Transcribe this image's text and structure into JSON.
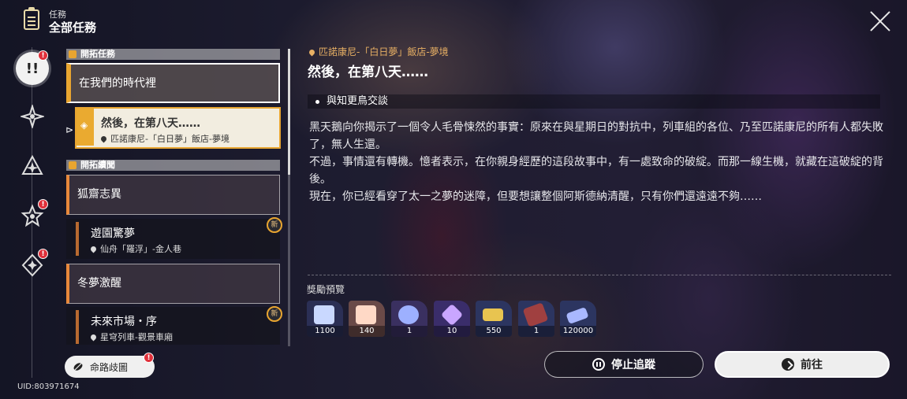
{
  "header": {
    "small_label": "任務",
    "title": "全部任務",
    "icon": "clipboard-icon"
  },
  "close": {
    "icon": "close-icon"
  },
  "rail": [
    {
      "name": "rail-all-quests",
      "icon": "exclamation-icon",
      "label": "!!",
      "badge": "!",
      "active": true
    },
    {
      "name": "rail-trailblaze",
      "icon": "star-compass-icon",
      "badge": ""
    },
    {
      "name": "rail-companion",
      "icon": "triangle-star-icon",
      "badge": ""
    },
    {
      "name": "rail-adventure",
      "icon": "star-icon",
      "badge": "!"
    },
    {
      "name": "rail-daily",
      "icon": "diamond-star-icon",
      "badge": "!"
    }
  ],
  "route_button": {
    "label": "命路歧圖",
    "icon": "leaf-icon",
    "badge": "!"
  },
  "uid": "UID:803971674",
  "sections": [
    {
      "title": "開拓任務"
    },
    {
      "title": "開拓續聞"
    }
  ],
  "quests": {
    "cat1": "在我們的時代裡",
    "cur_title": "然後，在第八天……",
    "cur_loc": "匹諾康尼-「白日夢」飯店-夢境",
    "cat2": "狐齋志異",
    "sub2_title": "遊園驚夢",
    "sub2_loc": "仙舟「羅浮」-金人巷",
    "cat3": "冬夢激醒",
    "sub3_title": "未來市場・序",
    "sub3_loc": "星穹列車-觀景車廂",
    "new_badge": "新"
  },
  "detail": {
    "location": "匹諾康尼-「白日夢」飯店-夢境",
    "title": "然後，在第八天……",
    "objective": "與知更鳥交談",
    "paragraphs": [
      "黑天鵝向你揭示了一個令人毛骨悚然的事實：原來在與星期日的對抗中，列車組的各位、乃至匹諾康尼的所有人都失敗了，無人生還。",
      "不過，事情還有轉機。憶者表示，在你親身經歷的這段故事中，有一處致命的破綻。而那一線生機，就藏在這破綻的背後。",
      "現在，你已經看穿了太一之夢的迷障，但要想讓整個阿斯德納清醒，只有你們還遠遠不夠……"
    ]
  },
  "rewards": {
    "title": "獎勵預覽",
    "items": [
      {
        "name": "reward-material",
        "count": "1100",
        "color": "#c9d8ff"
      },
      {
        "name": "reward-crystal",
        "count": "140",
        "color": "#ffd9c6"
      },
      {
        "name": "reward-orb",
        "count": "1",
        "color": "#9db0ff"
      },
      {
        "name": "reward-gem",
        "count": "10",
        "color": "#c9a6ff"
      },
      {
        "name": "reward-ticket",
        "count": "550",
        "color": "#e8c450"
      },
      {
        "name": "reward-book",
        "count": "1",
        "color": "#a04040"
      },
      {
        "name": "reward-credit",
        "count": "120000",
        "color": "#a9b8ff"
      }
    ]
  },
  "buttons": {
    "stop": "停止追蹤",
    "go": "前往"
  }
}
